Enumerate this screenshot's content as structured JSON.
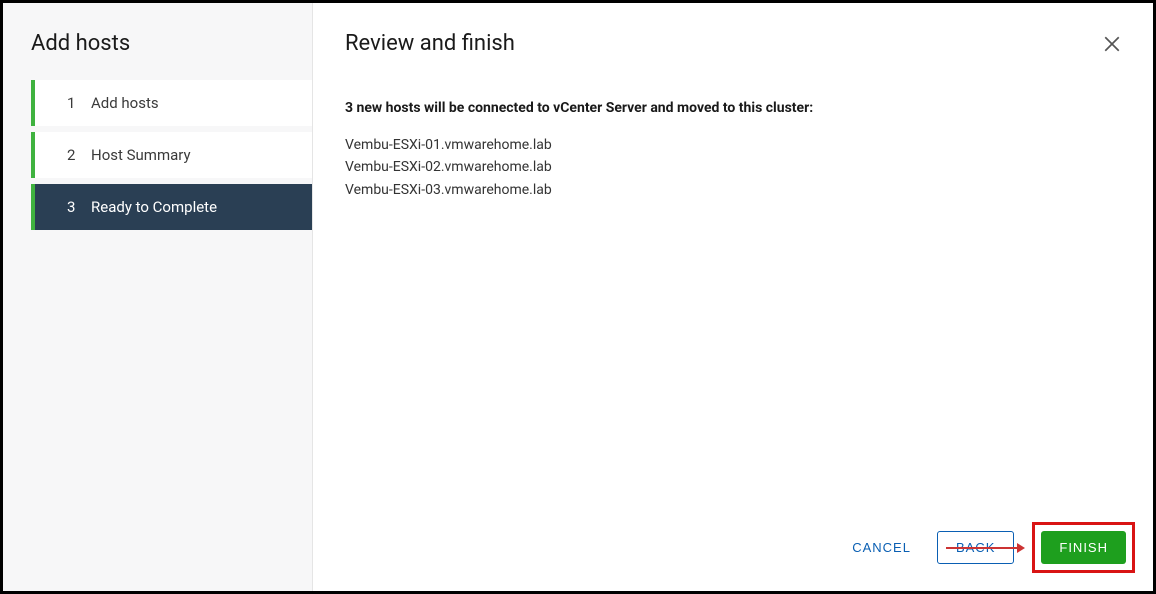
{
  "sidebar": {
    "title": "Add hosts",
    "steps": [
      {
        "num": "1",
        "label": "Add hosts"
      },
      {
        "num": "2",
        "label": "Host Summary"
      },
      {
        "num": "3",
        "label": "Ready to Complete"
      }
    ]
  },
  "content": {
    "title": "Review and finish",
    "summary_heading": "3 new hosts will be connected to vCenter Server and moved to this cluster:",
    "hosts": [
      "Vembu-ESXi-01.vmwarehome.lab",
      "Vembu-ESXi-02.vmwarehome.lab",
      "Vembu-ESXi-03.vmwarehome.lab"
    ]
  },
  "footer": {
    "cancel": "CANCEL",
    "back": "BACK",
    "finish": "FINISH"
  }
}
